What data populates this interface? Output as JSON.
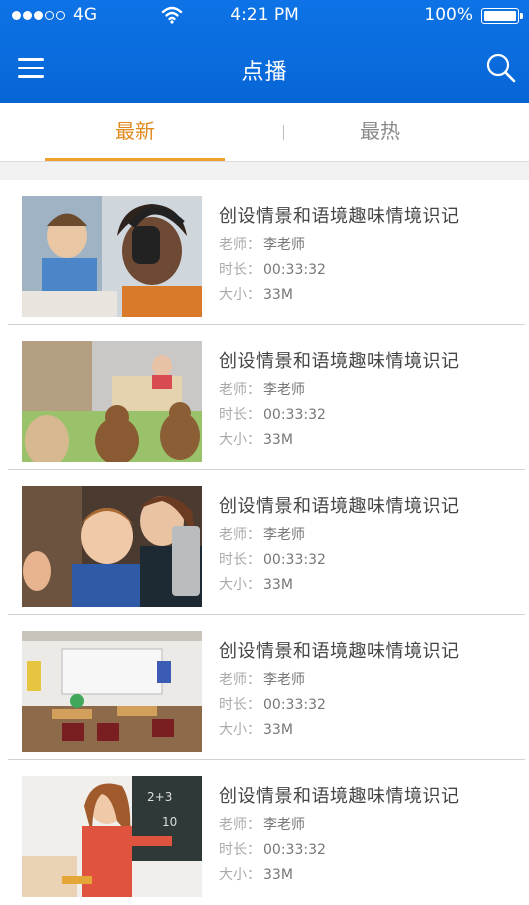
{
  "status_bar": {
    "carrier": "4G",
    "time": "4:21 PM",
    "battery": "100%"
  },
  "header": {
    "title": "点播"
  },
  "tabs": [
    {
      "label": "最新",
      "active": true
    },
    {
      "label": "最热",
      "active": false
    }
  ],
  "labels": {
    "teacher": "老师：",
    "duration": "时长：",
    "size": "大小："
  },
  "videos": [
    {
      "title": "创设情景和语境趣味情境识记",
      "teacher": "李老师",
      "duration": "00:33:32",
      "size": "33M",
      "thumbnail": "kids-headphones"
    },
    {
      "title": "创设情景和语境趣味情境识记",
      "teacher": "李老师",
      "duration": "00:33:32",
      "size": "33M",
      "thumbnail": "teddy-bears-classroom"
    },
    {
      "title": "创设情景和语境趣味情境识记",
      "teacher": "李老师",
      "duration": "00:33:32",
      "size": "33M",
      "thumbnail": "teacher-with-boy-tablet"
    },
    {
      "title": "创设情景和语境趣味情境识记",
      "teacher": "李老师",
      "duration": "00:33:32",
      "size": "33M",
      "thumbnail": "empty-classroom"
    },
    {
      "title": "创设情景和语境趣味情境识记",
      "teacher": "李老师",
      "duration": "00:33:32",
      "size": "33M",
      "thumbnail": "girl-at-chalkboard"
    }
  ],
  "colors": {
    "header": "#0b6fe0",
    "active_tab": "#e08a1e",
    "inactive_tab": "#8a8a8a"
  }
}
